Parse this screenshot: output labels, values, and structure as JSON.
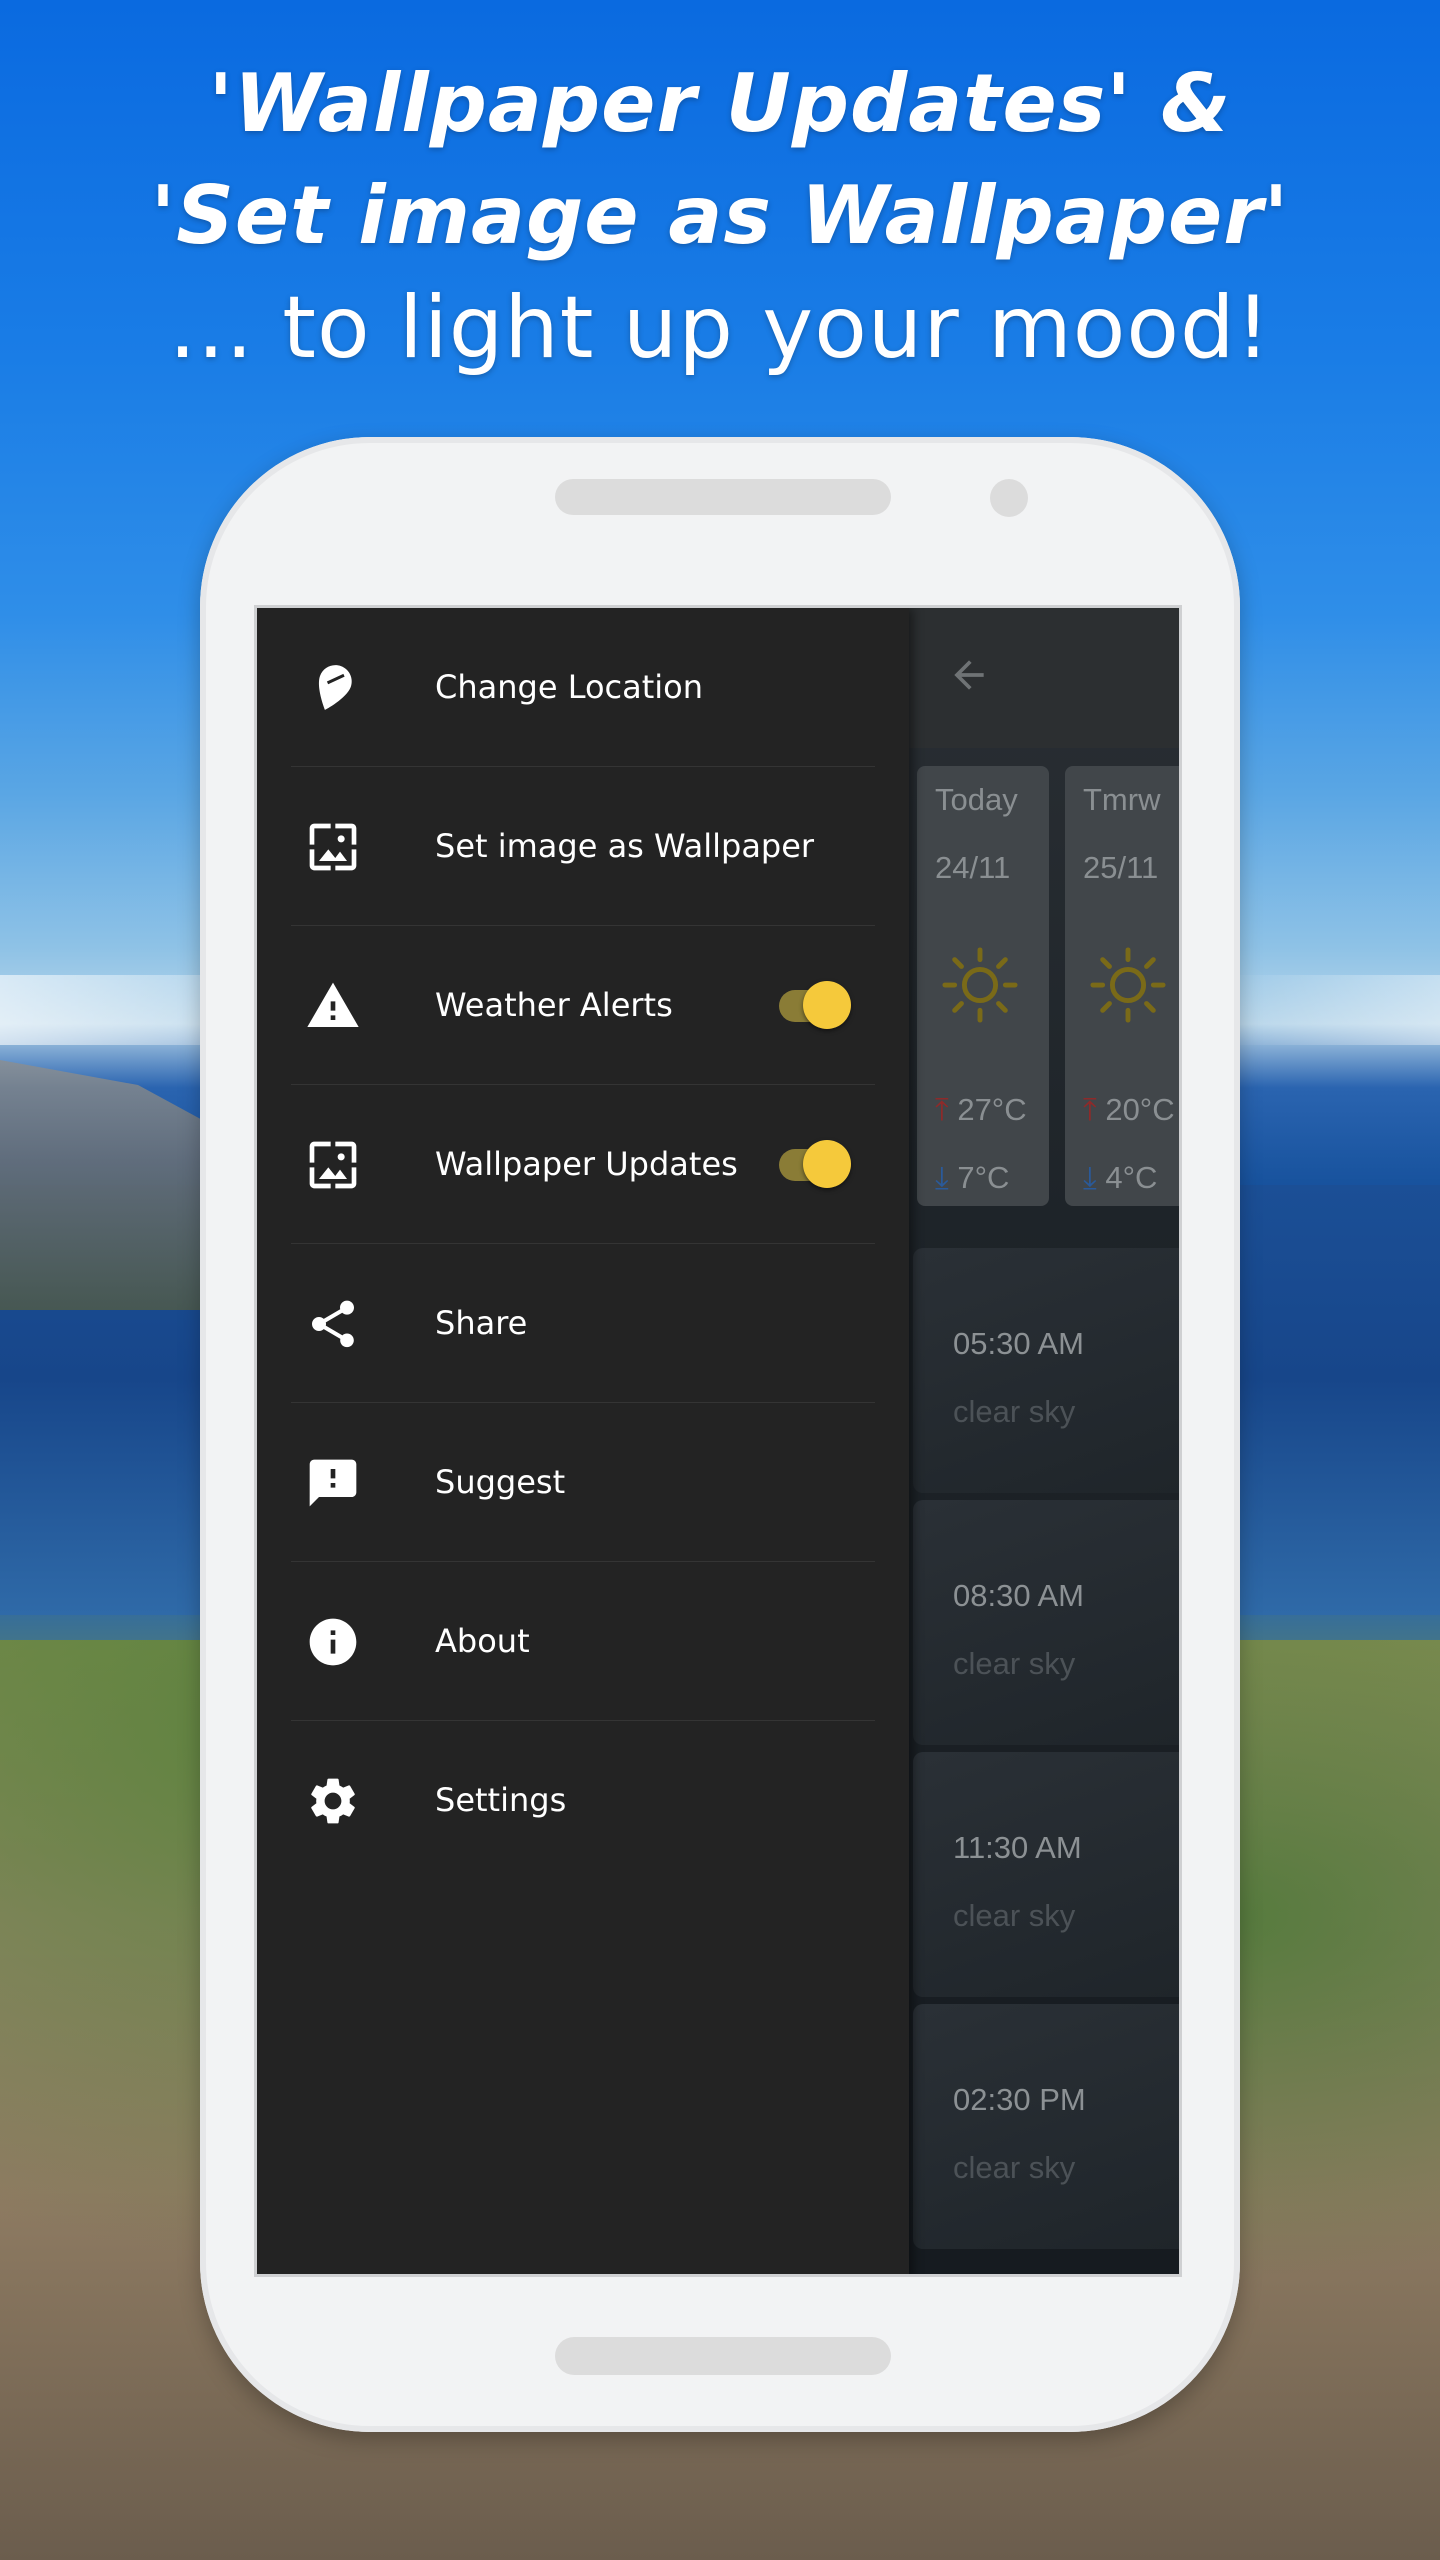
{
  "promo": {
    "line1": "'Wallpaper Updates' &",
    "line2": "'Set image as Wallpaper'",
    "line3": "... to light up your mood!"
  },
  "drawer": {
    "items": [
      {
        "label": "Change Location",
        "icon": "location-pin-icon"
      },
      {
        "label": "Set image as Wallpaper",
        "icon": "wallpaper-icon"
      },
      {
        "label": "Weather Alerts",
        "icon": "warning-icon",
        "toggle": true,
        "enabled": true
      },
      {
        "label": "Wallpaper Updates",
        "icon": "wallpaper-icon",
        "toggle": true,
        "enabled": true
      },
      {
        "label": "Share",
        "icon": "share-icon"
      },
      {
        "label": "Suggest",
        "icon": "feedback-icon"
      },
      {
        "label": "About",
        "icon": "info-icon"
      },
      {
        "label": "Settings",
        "icon": "gear-icon"
      }
    ]
  },
  "forecast": {
    "days": [
      {
        "label": "Today",
        "date": "24/11",
        "high": "27°C",
        "low": "7°C"
      },
      {
        "label": "Tmrw",
        "date": "25/11",
        "high": "20°C",
        "low": "4°C"
      }
    ],
    "hours": [
      {
        "time": "05:30 AM",
        "condition": "clear sky"
      },
      {
        "time": "08:30 AM",
        "condition": "clear sky"
      },
      {
        "time": "11:30 AM",
        "condition": "clear sky"
      },
      {
        "time": "02:30 PM",
        "condition": "clear sky"
      }
    ]
  },
  "colors": {
    "drawer_bg": "#232323",
    "toggle_accent": "#f5c93b",
    "sky": "#0a6ae0"
  }
}
